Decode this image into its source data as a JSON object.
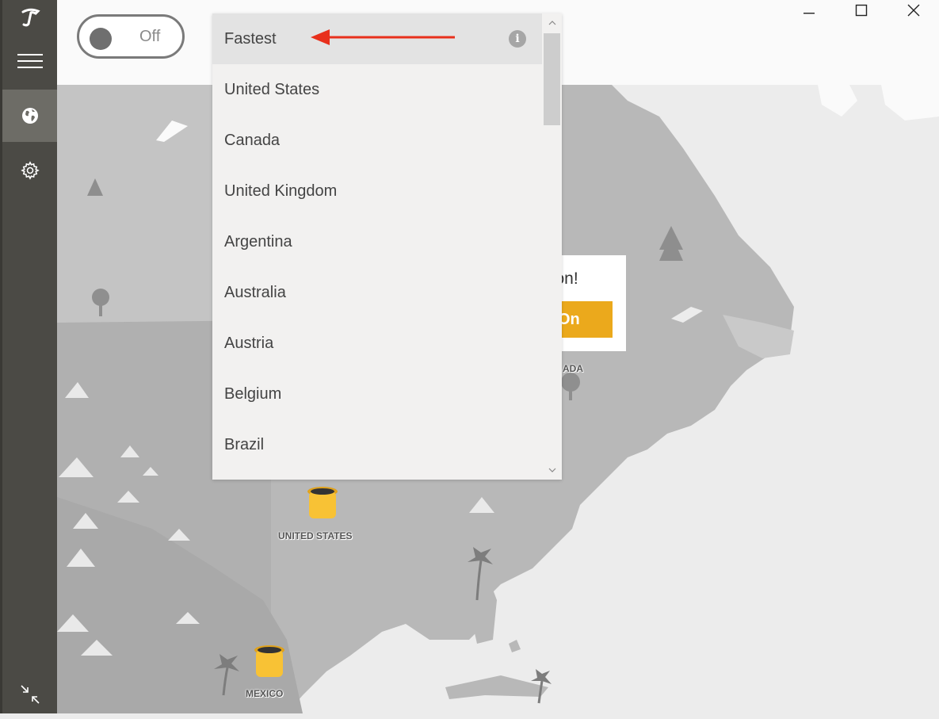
{
  "toggle": {
    "label": "Off"
  },
  "dropdown": {
    "items": [
      {
        "label": "Fastest",
        "selected": true
      },
      {
        "label": "United States"
      },
      {
        "label": "Canada"
      },
      {
        "label": "United Kingdom"
      },
      {
        "label": "Argentina"
      },
      {
        "label": "Australia"
      },
      {
        "label": "Austria"
      },
      {
        "label": "Belgium"
      },
      {
        "label": "Brazil"
      }
    ]
  },
  "promo": {
    "text": "tion!",
    "button": "On"
  },
  "map": {
    "labels": {
      "us": "UNITED STATES",
      "mexico": "MEXICO",
      "canada": "ADA"
    }
  },
  "colors": {
    "sidebar": "#4b4a45",
    "accent": "#eba91c",
    "annotation_arrow": "#e8301c",
    "pin": "#f8c235"
  },
  "icons": [
    "logo-icon",
    "menu-icon",
    "globe-icon",
    "gear-icon",
    "collapse-icon",
    "minimize-icon",
    "maximize-icon",
    "close-icon",
    "info-icon",
    "scroll-up-icon",
    "scroll-down-icon"
  ]
}
